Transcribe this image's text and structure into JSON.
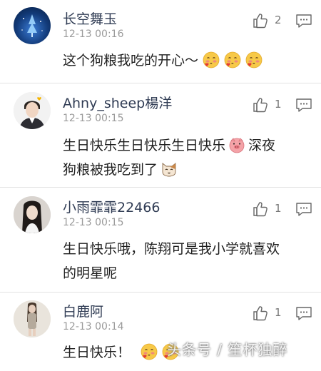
{
  "comments": [
    {
      "username": "长空舞玉",
      "timestamp": "12-13 00:16",
      "text": "这个狗粮我吃的开心～",
      "likes": "2",
      "emojis": [
        "blushing-heart-emoji",
        "blushing-heart-emoji",
        "blushing-heart-emoji"
      ]
    },
    {
      "username": "Ahny_sheep楊洋",
      "timestamp": "12-13 00:15",
      "text_line1_a": "生日快乐生日快乐生日快乐",
      "text_line1_b": "深夜",
      "text_line2": "狗粮被我吃到了",
      "likes": "1",
      "emojis": [
        "pig-face-emoji",
        "cat-face-emoji"
      ]
    },
    {
      "username": "小雨霏霏22466",
      "timestamp": "12-13 00:15",
      "text_line1": "生日快乐哦，陈翔可是我小学就喜欢",
      "text_line2": "的明星呢",
      "likes": "1"
    },
    {
      "username": "白鹿阿",
      "timestamp": "12-13 00:14",
      "text": "生日快乐！",
      "likes": "1",
      "emojis": [
        "blushing-heart-emoji",
        "blushing-heart-emoji"
      ]
    }
  ],
  "watermark": "头条号 / 笙杯独醉",
  "colors": {
    "username": "#303c54",
    "timestamp": "#9a9a9a",
    "text": "#1f1f1f",
    "divider": "#e3e3e3"
  }
}
